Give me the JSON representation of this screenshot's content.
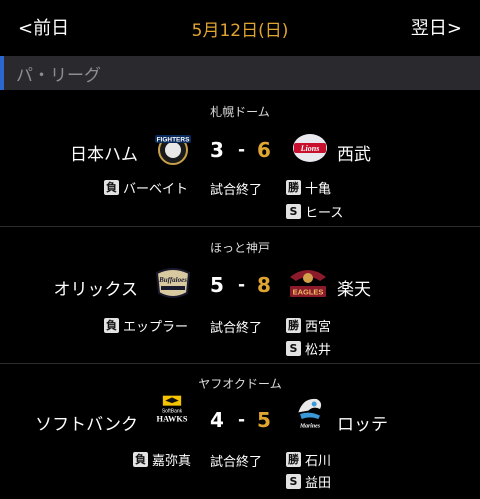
{
  "nav": {
    "prev_label": "<前日",
    "next_label": "翌日>",
    "date": "5月12日(日)"
  },
  "league": {
    "name": "パ・リーグ",
    "accent_color": "#2c67d0"
  },
  "colors": {
    "winning_score": "#e0a530",
    "background": "#000000",
    "header_bg": "#2a2a2e"
  },
  "games": [
    {
      "venue": "札幌ドーム",
      "home_team": "日本ハム",
      "home_score": "3",
      "away_score": "6",
      "away_team": "西武",
      "status": "試合終了",
      "losing_badge": "負",
      "losing_pitcher": "バーベイト",
      "winning_badge": "勝",
      "winning_pitcher": "十亀",
      "save_badge": "S",
      "save_pitcher": "ヒース",
      "home_logo_text": "FIGHTERS",
      "away_logo_text": "Lions"
    },
    {
      "venue": "ほっと神戸",
      "home_team": "オリックス",
      "home_score": "5",
      "away_score": "8",
      "away_team": "楽天",
      "status": "試合終了",
      "losing_badge": "負",
      "losing_pitcher": "エップラー",
      "winning_badge": "勝",
      "winning_pitcher": "西宮",
      "save_badge": "S",
      "save_pitcher": "松井",
      "home_logo_text": "Buffaloes",
      "away_logo_text": "EAGLES"
    },
    {
      "venue": "ヤフオクドーム",
      "home_team": "ソフトバンク",
      "home_score": "4",
      "away_score": "5",
      "away_team": "ロッテ",
      "status": "試合終了",
      "losing_badge": "負",
      "losing_pitcher": "嘉弥真",
      "winning_badge": "勝",
      "winning_pitcher": "石川",
      "save_badge": "S",
      "save_pitcher": "益田",
      "home_logo_text_1": "SoftBank",
      "home_logo_text_2": "HAWKS",
      "away_logo_text": "Marines"
    }
  ]
}
